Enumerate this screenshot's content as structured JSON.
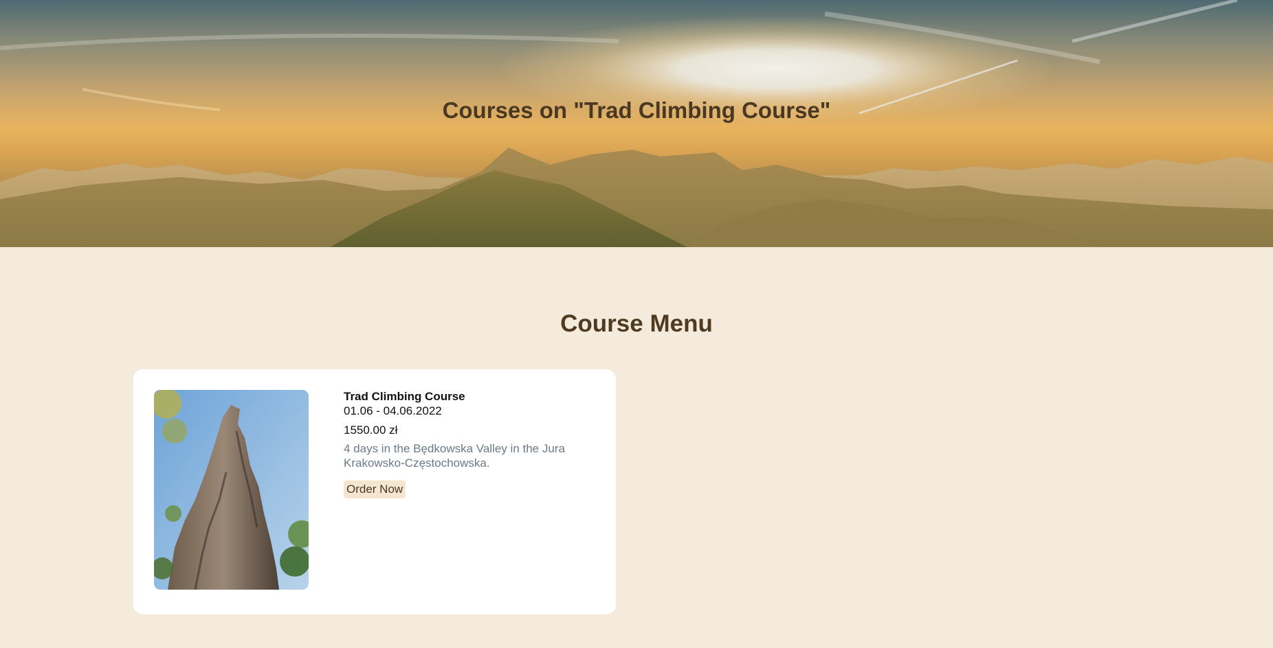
{
  "hero": {
    "title": "Courses on \"Trad Climbing Course\"",
    "image": "mountain-sunrise"
  },
  "menu": {
    "title": "Course Menu"
  },
  "courses": [
    {
      "name": "Trad Climbing Course",
      "dates": "01.06 - 04.06.2022",
      "price": "1550.00 zł",
      "description": "4 days in the Będkowska Valley in the Jura Krakowsko-Częstochowska.",
      "button_label": "Order Now",
      "image": "rock-tower-photo"
    }
  ],
  "colors": {
    "page_background": "#f5ebdc",
    "title_color": "#4e3b22",
    "card_background": "#ffffff",
    "description_color": "#6b7a88",
    "button_background": "#f5e6d2"
  }
}
